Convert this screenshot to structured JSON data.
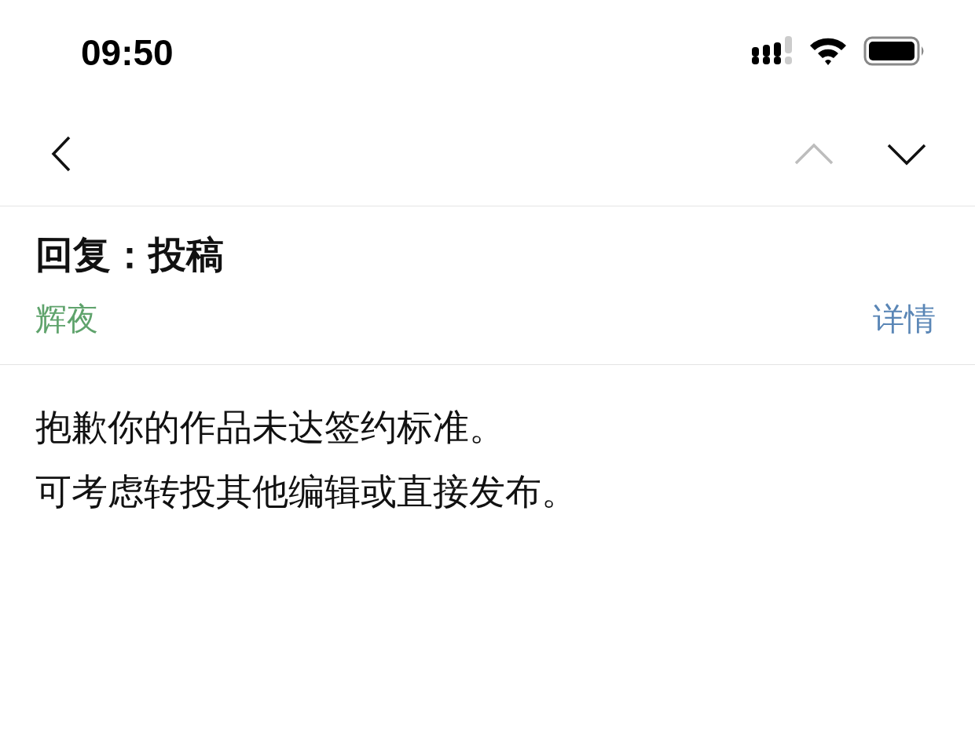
{
  "status_bar": {
    "time": "09:50"
  },
  "nav": {
    "prev_disabled": true,
    "next_disabled": false
  },
  "message": {
    "subject": "回复：投稿",
    "sender": "辉夜",
    "details_link": "详情",
    "body": [
      "抱歉你的作品未达签约标准。",
      "可考虑转投其他编辑或直接发布。"
    ]
  }
}
